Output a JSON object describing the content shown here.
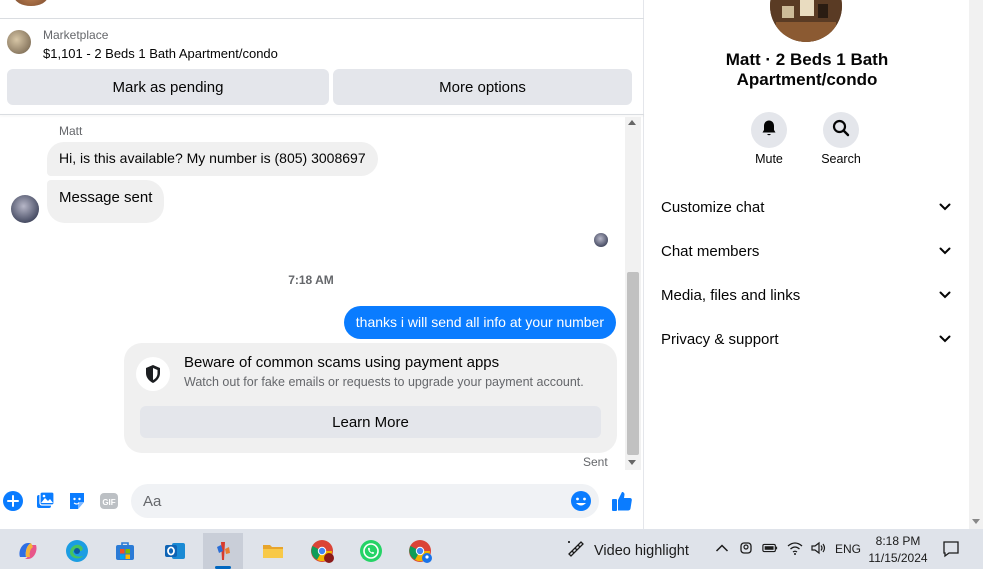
{
  "header": {
    "marketplace_label": "Marketplace",
    "listing_title": "$1,101 - 2 Beds 1 Bath Apartment/condo",
    "mark_pending_label": "Mark as pending",
    "more_options_label": "More options"
  },
  "thread": {
    "sender_name": "Matt",
    "incoming": [
      "Hi, is this available? My number is (805) 3008697",
      "Message sent"
    ],
    "timestamp": "7:18 AM",
    "outgoing": "thanks i will send all info at your number",
    "scam_notice": {
      "title": "Beware of common scams using payment apps",
      "subtitle": "Watch out for fake emails or requests to upgrade your payment account.",
      "button_label": "Learn More"
    },
    "status": "Sent"
  },
  "composer": {
    "placeholder": "Aa",
    "icons": [
      "plus-icon",
      "photo-icon",
      "sticker-icon",
      "gif-icon",
      "emoji-icon",
      "thumbs-up-icon"
    ]
  },
  "info_panel": {
    "name_line1": "Matt · 2 Beds 1 Bath",
    "name_line2": "Apartment/condo",
    "actions": [
      {
        "label": "Mute",
        "icon": "bell-icon"
      },
      {
        "label": "Search",
        "icon": "search-icon"
      }
    ],
    "sections": [
      "Customize chat",
      "Chat members",
      "Media, files and links",
      "Privacy & support"
    ]
  },
  "taskbar": {
    "apps": [
      "copilot",
      "edge",
      "store",
      "outlook",
      "app-active",
      "file-explorer",
      "chrome",
      "whatsapp",
      "chrome-profile"
    ],
    "video_highlight": "Video highlight",
    "language": "ENG",
    "time": "8:18 PM",
    "date": "11/15/2024"
  },
  "colors": {
    "accent_blue": "#0a7cff",
    "bubble_gray": "#f0f0f0",
    "button_gray": "#e4e6eb"
  }
}
